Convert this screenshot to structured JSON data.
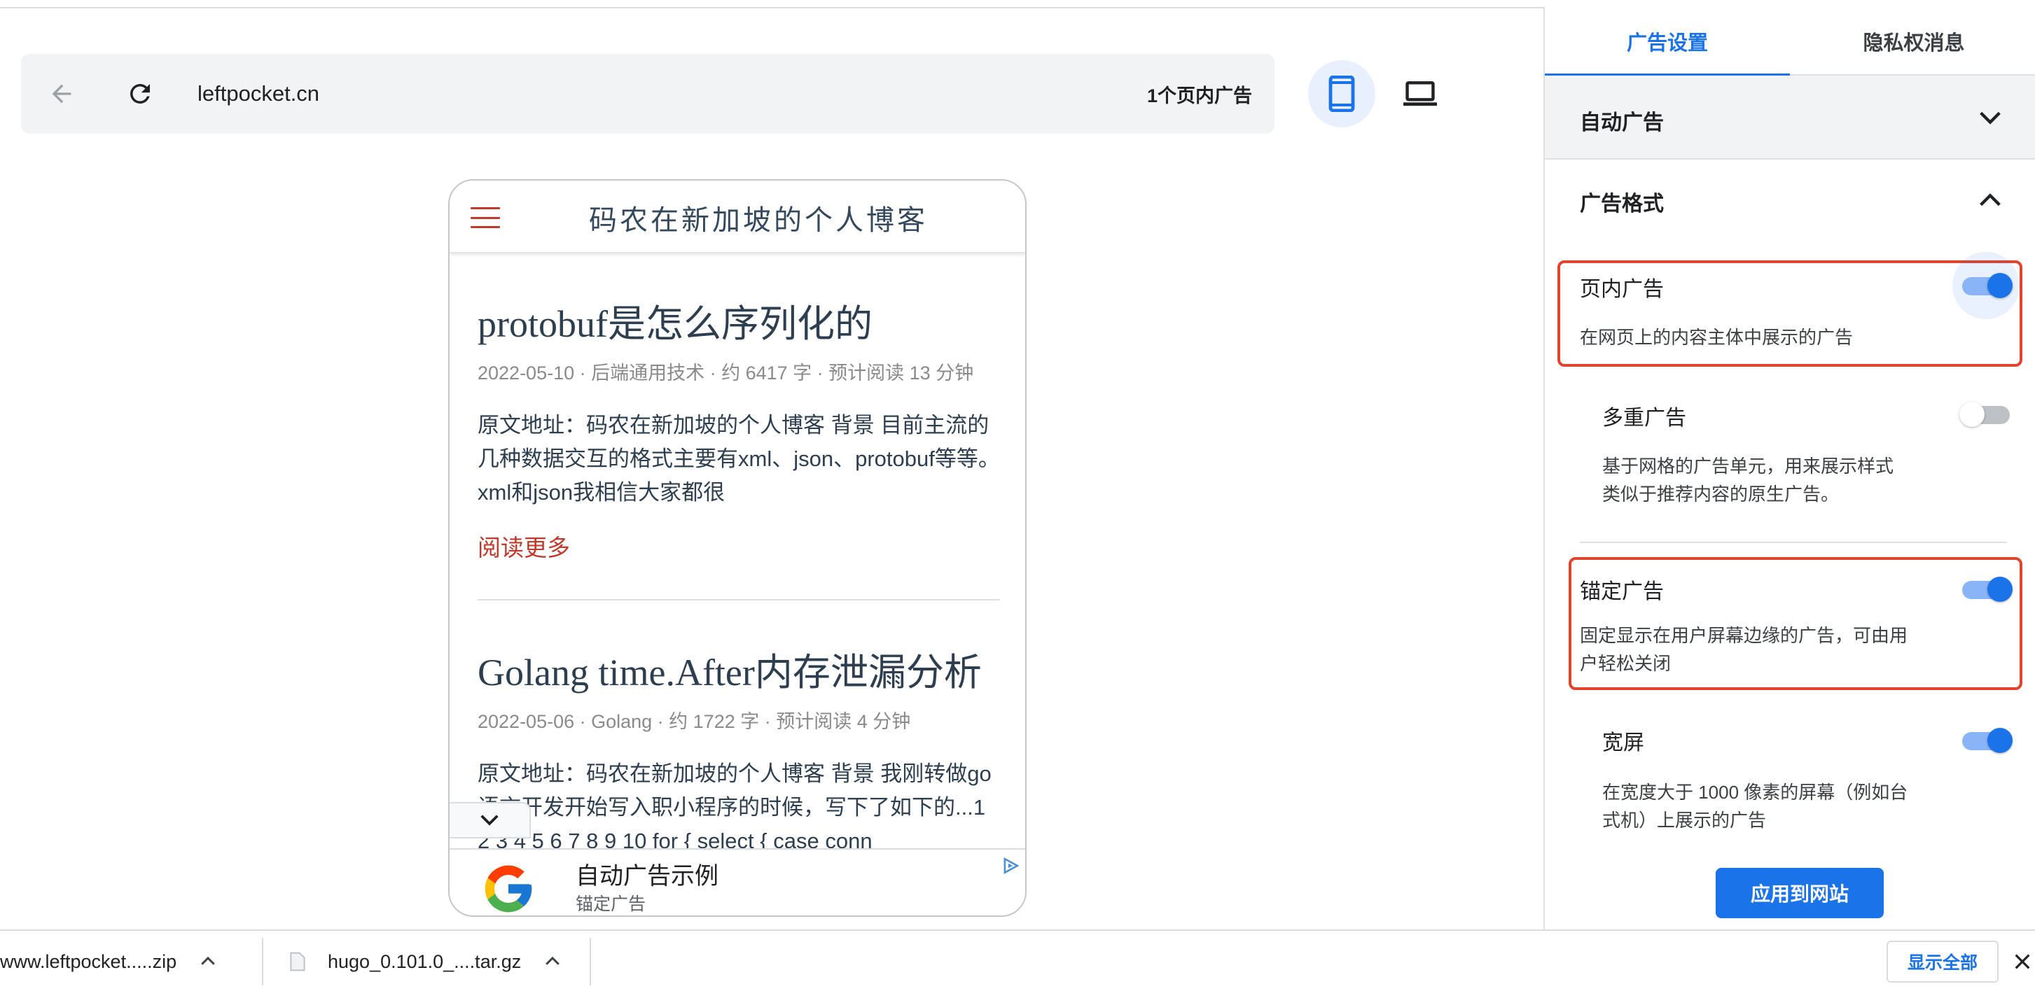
{
  "browser": {
    "url": "leftpocket.cn",
    "ad_count": "1个页内广告"
  },
  "preview": {
    "blog_title": "码农在新加坡的个人博客",
    "posts": [
      {
        "title": "protobuf是怎么序列化的",
        "meta": "2022-05-10 · 后端通用技术 · 约 6417 字 · 预计阅读 13 分钟",
        "excerpt": "原文地址：码农在新加坡的个人博客 背景 目前主流的几种数据交互的格式主要有xml、json、protobuf等等。xml和json我相信大家都很",
        "read_more": "阅读更多"
      },
      {
        "title": "Golang time.After内存泄漏分析",
        "meta": "2022-05-06 · Golang · 约 1722 字 · 预计阅读 4 分钟",
        "excerpt": "原文地址：码农在新加坡的个人博客 背景 我刚转做go语言开发开始写入职小程序的时候，写下了如下的...1 2 3 4 5 6 7 8 9 10 for { select { case conn"
      }
    ],
    "ad_banner": {
      "title": "自动广告示例",
      "subtitle": "锚定广告"
    }
  },
  "panel": {
    "tabs": [
      "广告设置",
      "隐私权消息"
    ],
    "auto_ads_label": "自动广告",
    "ad_formats_label": "广告格式",
    "settings": [
      {
        "title": "页内广告",
        "desc": "在网页上的内容主体中展示的广告",
        "enabled": true
      },
      {
        "title": "多重广告",
        "desc_lines": [
          "基于网格的广告单元，用来展示样式",
          "类似于推荐内容的原生广告。"
        ],
        "enabled": false
      },
      {
        "title": "锚定广告",
        "desc_lines": [
          "固定显示在用户屏幕边缘的广告，可由用",
          "户轻松关闭"
        ],
        "enabled": true
      },
      {
        "title": "宽屏",
        "desc_lines": [
          "在宽度大于 1000 像素的屏幕（例如台",
          "式机）上展示的广告"
        ],
        "enabled": true
      }
    ],
    "apply_button": "应用到网站"
  },
  "downloads": {
    "items": [
      "www.leftpocket.....zip",
      "hugo_0.101.0_....tar.gz"
    ],
    "show_all": "显示全部"
  },
  "colors": {
    "accent": "#1a73e8",
    "highlight": "#e0442c",
    "link_red": "#c0392b"
  },
  "icons": [
    "back-arrow-icon",
    "reload-icon",
    "mobile-device-icon",
    "desktop-device-icon",
    "menu-icon",
    "chevron-down-icon",
    "chevron-up-icon",
    "google-logo-icon",
    "adchoices-icon",
    "file-icon",
    "close-icon"
  ]
}
